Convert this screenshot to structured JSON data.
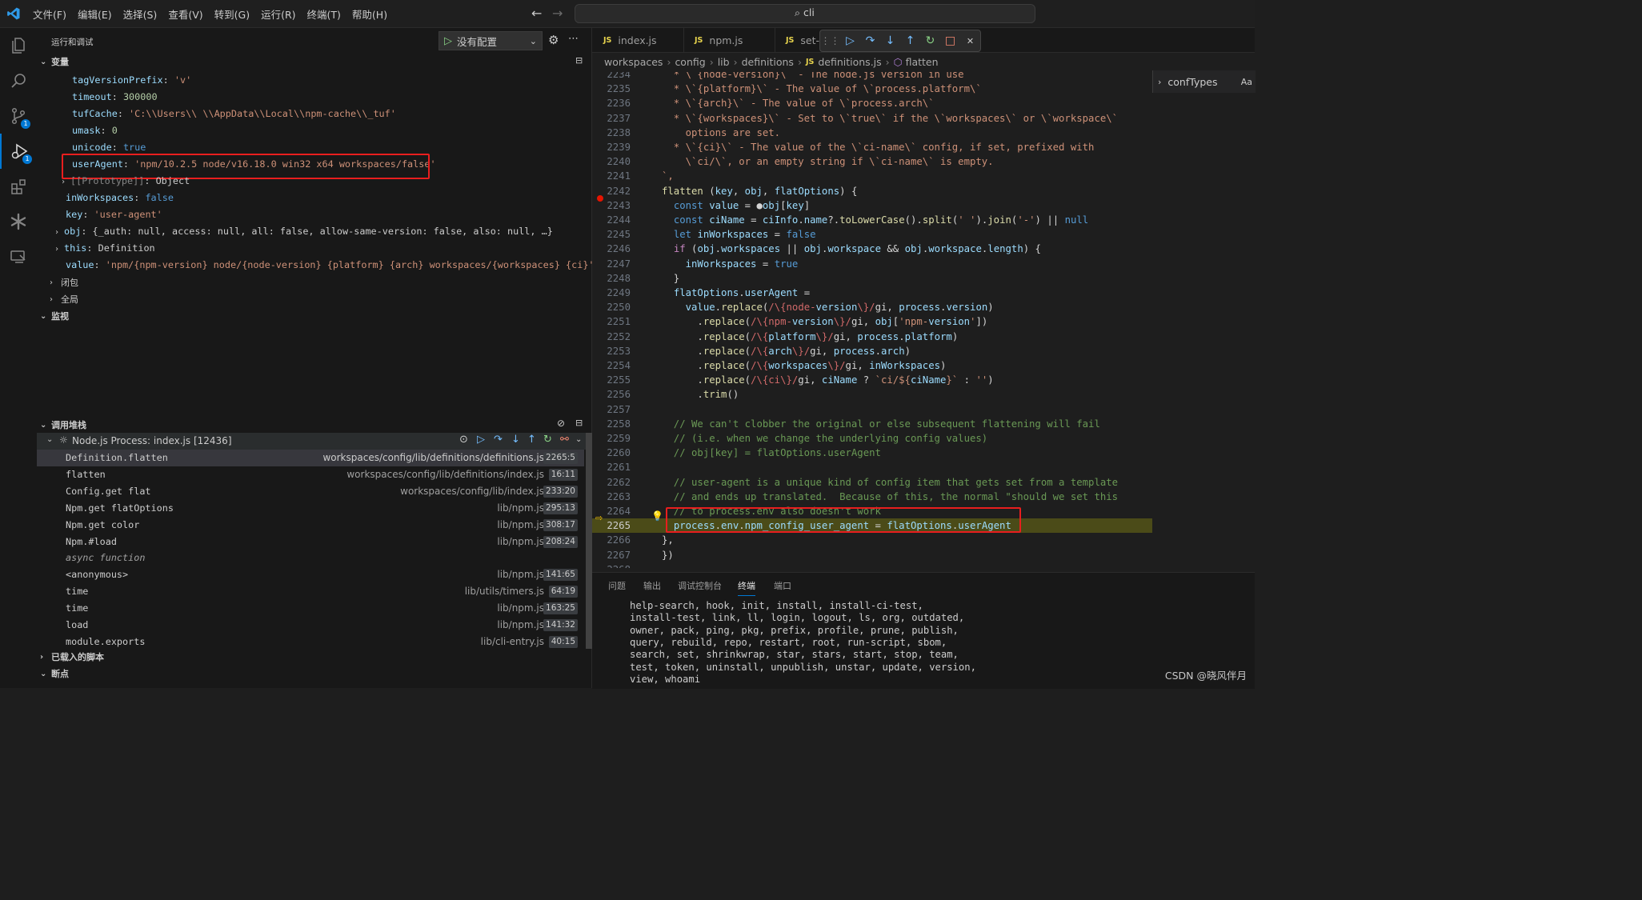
{
  "menu": [
    "文件(F)",
    "编辑(E)",
    "选择(S)",
    "查看(V)",
    "转到(G)",
    "运行(R)",
    "终端(T)",
    "帮助(H)"
  ],
  "search": {
    "query": "cli"
  },
  "sidebar": {
    "title": "运行和调试",
    "config_label": "没有配置",
    "sections": {
      "variables": "变量",
      "closure": "闭包",
      "global": "全局",
      "watch": "监视",
      "callstack": "调用堆栈",
      "loaded_scripts": "已载入的脚本",
      "breakpoints": "断点"
    },
    "variables": [
      {
        "key": "tagVersionPrefix",
        "value": "'v'"
      },
      {
        "key": "timeout",
        "value": "300000"
      },
      {
        "key": "tufCache",
        "value": "'C:\\\\Users\\\\      \\\\AppData\\\\Local\\\\npm-cache\\\\_tuf'"
      },
      {
        "key": "umask",
        "value": "0"
      },
      {
        "key": "unicode",
        "value": "true"
      },
      {
        "key": "userAgent",
        "value": "'npm/10.2.5 node/v16.18.0 win32 x64 workspaces/false'"
      },
      {
        "key": "[[Prototype]]",
        "value": "Object"
      },
      {
        "key": "inWorkspaces",
        "value": "false"
      },
      {
        "key": "key",
        "value": "'user-agent'"
      },
      {
        "key": "obj",
        "value": "{_auth: null, access: null, all: false, allow-same-version: false, also: null, …}"
      },
      {
        "key": "this",
        "value": "Definition"
      },
      {
        "key": "value",
        "value": "'npm/{npm-version} node/{node-version} {platform} {arch} workspaces/{workspaces} {ci}'"
      }
    ],
    "process": "Node.js Process: index.js [12436]",
    "frames": [
      {
        "fn": "Definition.flatten",
        "path": "workspaces/config/lib/definitions/definitions.js",
        "line": "2265:5"
      },
      {
        "fn": "flatten",
        "path": "workspaces/config/lib/definitions/index.js",
        "line": "16:11"
      },
      {
        "fn": "Config.get flat",
        "path": "workspaces/config/lib/index.js",
        "line": "233:20"
      },
      {
        "fn": "Npm.get flatOptions",
        "path": "lib/npm.js",
        "line": "295:13"
      },
      {
        "fn": "Npm.get color",
        "path": "lib/npm.js",
        "line": "308:17"
      },
      {
        "fn": "Npm.#load",
        "path": "lib/npm.js",
        "line": "208:24"
      },
      {
        "fn": "async function",
        "path": "",
        "line": ""
      },
      {
        "fn": "<anonymous>",
        "path": "lib/npm.js",
        "line": "141:65"
      },
      {
        "fn": "time",
        "path": "lib/utils/timers.js",
        "line": "64:19"
      },
      {
        "fn": "time",
        "path": "lib/npm.js",
        "line": "163:25"
      },
      {
        "fn": "load",
        "path": "lib/npm.js",
        "line": "141:32"
      },
      {
        "fn": "module.exports",
        "path": "lib/cli-entry.js",
        "line": "40:15"
      }
    ]
  },
  "editor": {
    "tabs": [
      "index.js",
      "npm.js",
      "set-"
    ],
    "breadcrumb": [
      "workspaces",
      "config",
      "lib",
      "definitions",
      "definitions.js",
      "flatten"
    ],
    "outline": "confTypes",
    "outline_extra": "Aa",
    "lines": [
      {
        "n": "2234",
        "code": "  * \\`{node-version}\\` - The node.js version in use"
      },
      {
        "n": "2235",
        "code": "  * \\`{platform}\\` - The value of \\`process.platform\\`"
      },
      {
        "n": "2236",
        "code": "  * \\`{arch}\\` - The value of \\`process.arch\\`"
      },
      {
        "n": "2237",
        "code": "  * \\`{workspaces}\\` - Set to \\`true\\` if the \\`workspaces\\` or \\`workspace\\`"
      },
      {
        "n": "2238",
        "code": "    options are set."
      },
      {
        "n": "2239",
        "code": "  * \\`{ci}\\` - The value of the \\`ci-name\\` config, if set, prefixed with"
      },
      {
        "n": "2240",
        "code": "    \\`ci/\\`, or an empty string if \\`ci-name\\` is empty."
      },
      {
        "n": "2241",
        "code": "`,"
      },
      {
        "n": "2242",
        "code": "flatten (key, obj, flatOptions) {"
      },
      {
        "n": "2243",
        "code": "  const value = ●obj[key]"
      },
      {
        "n": "2244",
        "code": "  const ciName = ciInfo.name?.toLowerCase().split(' ').join('-') || null"
      },
      {
        "n": "2245",
        "code": "  let inWorkspaces = false"
      },
      {
        "n": "2246",
        "code": "  if (obj.workspaces || obj.workspace && obj.workspace.length) {"
      },
      {
        "n": "2247",
        "code": "    inWorkspaces = true"
      },
      {
        "n": "2248",
        "code": "  }"
      },
      {
        "n": "2249",
        "code": "  flatOptions.userAgent ="
      },
      {
        "n": "2250",
        "code": "    value.replace(/\\{node-version\\}/gi, process.version)"
      },
      {
        "n": "2251",
        "code": "      .replace(/\\{npm-version\\}/gi, obj['npm-version'])"
      },
      {
        "n": "2252",
        "code": "      .replace(/\\{platform\\}/gi, process.platform)"
      },
      {
        "n": "2253",
        "code": "      .replace(/\\{arch\\}/gi, process.arch)"
      },
      {
        "n": "2254",
        "code": "      .replace(/\\{workspaces\\}/gi, inWorkspaces)"
      },
      {
        "n": "2255",
        "code": "      .replace(/\\{ci\\}/gi, ciName ? `ci/${ciName}` : '')"
      },
      {
        "n": "2256",
        "code": "      .trim()"
      },
      {
        "n": "2257",
        "code": ""
      },
      {
        "n": "2258",
        "code": "  // We can't clobber the original or else subsequent flattening will fail"
      },
      {
        "n": "2259",
        "code": "  // (i.e. when we change the underlying config values)"
      },
      {
        "n": "2260",
        "code": "  // obj[key] = flatOptions.userAgent"
      },
      {
        "n": "2261",
        "code": ""
      },
      {
        "n": "2262",
        "code": "  // user-agent is a unique kind of config item that gets set from a template"
      },
      {
        "n": "2263",
        "code": "  // and ends up translated.  Because of this, the normal \"should we set this"
      },
      {
        "n": "2264",
        "code": "  // to process.env also doesn't work"
      },
      {
        "n": "2265",
        "code": "  process.env.npm_config_user_agent = flatOptions.userAgent"
      },
      {
        "n": "2266",
        "code": "},"
      },
      {
        "n": "2267",
        "code": "})"
      },
      {
        "n": "2268",
        "code": ""
      }
    ]
  },
  "panel": {
    "tabs": [
      "问题",
      "输出",
      "调试控制台",
      "终端",
      "端口"
    ],
    "active": "终端",
    "terminal": [
      "help-search, hook, init, install, install-ci-test,",
      "install-test, link, ll, login, logout, ls, org, outdated,",
      "owner, pack, ping, pkg, prefix, profile, prune, publish,",
      "query, rebuild, repo, restart, root, run-script, sbom,",
      "search, set, shrinkwrap, star, stars, start, stop, team,",
      "test, token, uninstall, unpublish, unstar, update, version,",
      "view, whoami"
    ]
  },
  "watermark": "CSDN @晓风伴月",
  "colors": {
    "accent": "#0078d4",
    "highlight_box": "#e81e1e",
    "current_line": "#4b4b18"
  }
}
